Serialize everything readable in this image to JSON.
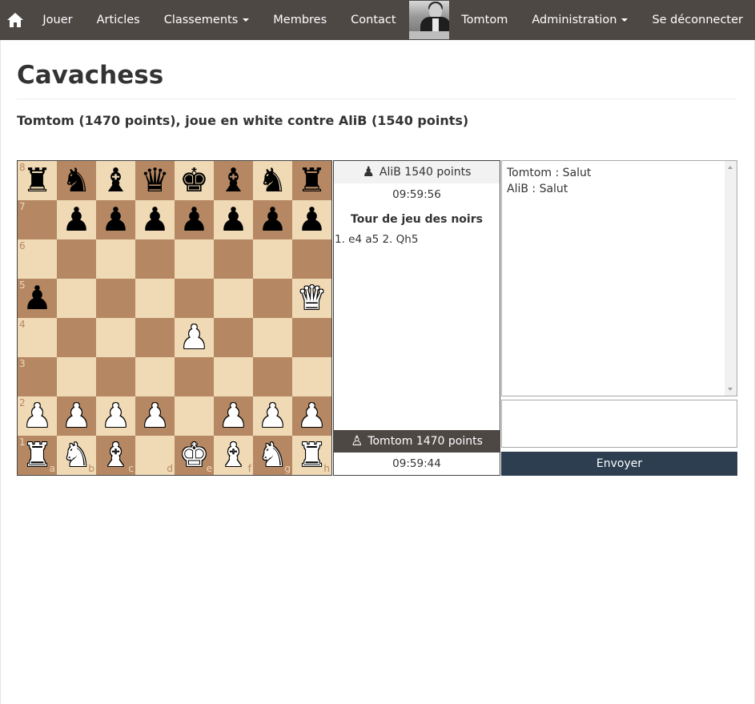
{
  "navbar": {
    "home_icon": "home-icon",
    "items": {
      "jouer": "Jouer",
      "articles": "Articles",
      "classements": "Classements",
      "membres": "Membres",
      "contact": "Contact",
      "user": "Tomtom",
      "administration": "Administration",
      "logout": "Se déconnecter"
    },
    "bg_color": "#4e4845"
  },
  "page": {
    "title": "Cavachess",
    "subtitle": "Tomtom (1470 points), joue en white contre AliB (1540 points)"
  },
  "board": {
    "light_color": "#f0d9b5",
    "dark_color": "#b58863",
    "ranks": [
      "8",
      "7",
      "6",
      "5",
      "4",
      "3",
      "2",
      "1"
    ],
    "files": [
      "a",
      "b",
      "c",
      "d",
      "e",
      "f",
      "g",
      "h"
    ],
    "position": [
      [
        "bR",
        "bN",
        "bB",
        "bQ",
        "bK",
        "bB",
        "bN",
        "bR"
      ],
      [
        "",
        "bP",
        "bP",
        "bP",
        "bP",
        "bP",
        "bP",
        "bP"
      ],
      [
        "",
        "",
        "",
        "",
        "",
        "",
        "",
        ""
      ],
      [
        "bP",
        "",
        "",
        "",
        "",
        "",
        "",
        "wQ"
      ],
      [
        "",
        "",
        "",
        "",
        "wP",
        "",
        "",
        ""
      ],
      [
        "",
        "",
        "",
        "",
        "",
        "",
        "",
        ""
      ],
      [
        "wP",
        "wP",
        "wP",
        "wP",
        "",
        "wP",
        "wP",
        "wP"
      ],
      [
        "wR",
        "wN",
        "wB",
        "",
        "wK",
        "wB",
        "wN",
        "wR"
      ]
    ]
  },
  "game": {
    "opponent_label": "AliB 1540 points",
    "opponent_clock": "09:59:56",
    "turn_label": "Tour de jeu des noirs",
    "moves": "1. e4 a5 2. Qh5",
    "me_label": "Tomtom 1470 points",
    "me_clock": "09:59:44"
  },
  "chat": {
    "messages": [
      "Tomtom : Salut",
      "AliB : Salut"
    ],
    "input_value": "",
    "send_label": "Envoyer",
    "send_color": "#2c3e50"
  }
}
